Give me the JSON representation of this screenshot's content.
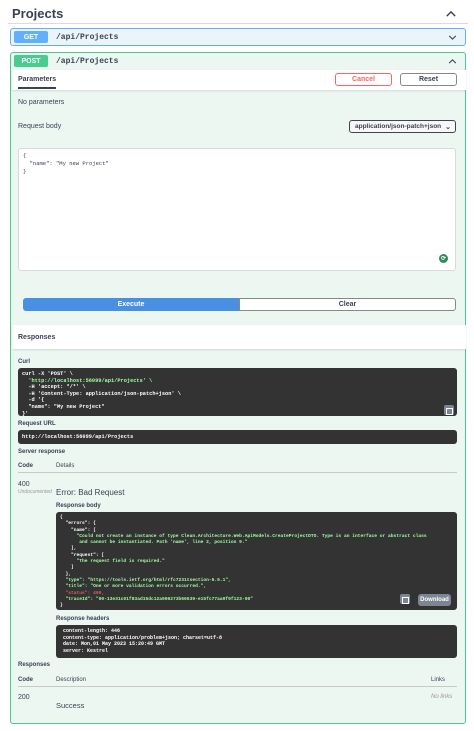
{
  "tag": {
    "title": "Projects"
  },
  "get_op": {
    "method": "GET",
    "path": "/api/Projects"
  },
  "post_op": {
    "method": "POST",
    "path": "/api/Projects",
    "parameters_tab": "Parameters",
    "cancel_label": "Cancel",
    "reset_label": "Reset",
    "no_params": "No parameters",
    "request_body_label": "Request body",
    "content_type": "application/json-patch+json",
    "request_body": "{\n  \"name\": \"My new Project\"\n}",
    "execute_label": "Execute",
    "clear_label": "Clear",
    "responses_title": "Responses",
    "curl_label": "Curl",
    "curl_lines": [
      "curl -X 'POST' \\",
      "  'http://localhost:56099/api/Projects' \\",
      "  -H 'accept: */*' \\",
      "  -H 'Content-Type: application/json-patch+json' \\",
      "  -d '{",
      "  \"name\": \"My new Project\"",
      "}'"
    ],
    "request_url_label": "Request URL",
    "request_url": "http://localhost:56099/api/Projects",
    "server_response_label": "Server response",
    "code_header": "Code",
    "details_header": "Details",
    "response_code": "400",
    "undocumented": "Undocumented",
    "error_title": "Error: Bad Request",
    "response_body_label": "Response body",
    "response_body_lines": [
      "{",
      "  \"errors\": {",
      "    \"name\": [",
      "      \"Could not create an instance of type Clean.Architecture.Web.ApiModels.CreateProjectDTO. Type is an interface or abstract class",
      "       and cannot be instantiated. Path 'name', line 2, position 9.\"",
      "    ],",
      "    \"request\": [",
      "      \"The request field is required.\"",
      "    ]",
      "  },",
      "  \"type\": \"https://tools.ietf.org/html/rfc7231#section-6.5.1\",",
      "  \"title\": \"One or more validation errors occurred.\",",
      "  \"status\": 400,",
      "  \"traceId\": \"00-13e31c01f83ad15dc12a906273b66639-e15fc77aa9f9f123-00\"",
      "}"
    ],
    "download_label": "Download",
    "response_headers_label": "Response headers",
    "response_headers": [
      " content-length: 446",
      " content-type: application/problem+json; charset=utf-8",
      " date: Mon,01 May 2023 15:20:49 GMT",
      " server: Kestrel"
    ],
    "responses2_title": "Responses",
    "table_headers": {
      "code": "Code",
      "description": "Description",
      "links": "Links"
    },
    "row": {
      "code": "200",
      "description": "Success",
      "links": "No links"
    }
  },
  "colors": {
    "get": "#61affe",
    "post": "#49cc90",
    "execute": "#4990e2",
    "cancel": "#ff6060"
  },
  "icons": [
    "chevron-up-icon",
    "copy-icon",
    "json-edit-icon"
  ]
}
